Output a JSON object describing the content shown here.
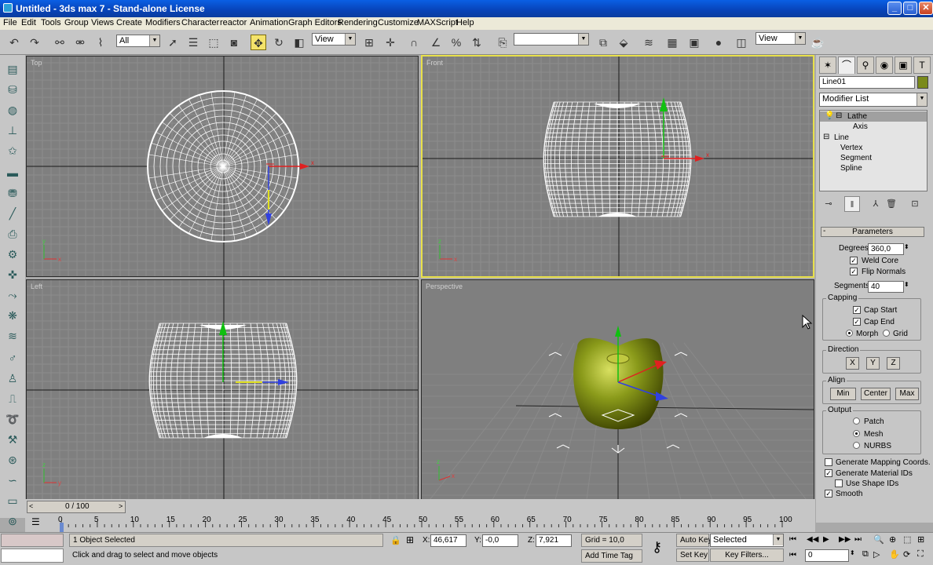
{
  "window": {
    "title": "Untitled    - 3ds max 7    - Stand-alone License",
    "min": "_",
    "max": "□",
    "close": "✕"
  },
  "menu": [
    "File",
    "Edit",
    "Tools",
    "Group",
    "Views",
    "Create",
    "Modifiers",
    "Character",
    "reactor",
    "Animation",
    "Graph Editors",
    "Rendering",
    "Customize",
    "MAXScript",
    "Help"
  ],
  "toolbar": {
    "selection_filter": "All",
    "ref_coord": "View",
    "named_sel": "",
    "render_view": "View"
  },
  "viewports": {
    "top": "Top",
    "front": "Front",
    "left": "Left",
    "perspective": "Perspective"
  },
  "axis": {
    "x": "x",
    "y": "y",
    "z": "z"
  },
  "command_panel": {
    "object_name": "Line01",
    "modifier_list": "Modifier List",
    "stack": {
      "lathe": "Lathe",
      "axis": "Axis",
      "line": "Line",
      "vertex": "Vertex",
      "segment": "Segment",
      "spline": "Spline"
    },
    "rollout": "Parameters",
    "degrees_label": "Degrees:",
    "degrees": "360,0",
    "weld_core": "Weld Core",
    "flip_normals": "Flip Normals",
    "segments_label": "Segments:",
    "segments": "40",
    "capping": "Capping",
    "cap_start": "Cap Start",
    "cap_end": "Cap End",
    "morph": "Morph",
    "grid": "Grid",
    "direction": "Direction",
    "dir_x": "X",
    "dir_y": "Y",
    "dir_z": "Z",
    "align": "Align",
    "min": "Min",
    "center": "Center",
    "max": "Max",
    "output": "Output",
    "patch": "Patch",
    "mesh": "Mesh",
    "nurbs": "NURBS",
    "gen_mapping": "Generate Mapping Coords.",
    "gen_material": "Generate Material IDs",
    "use_shape": "Use Shape IDs",
    "smooth": "Smooth"
  },
  "timeline": {
    "frame": "0 / 100",
    "ticks": [
      "0",
      "5",
      "10",
      "15",
      "20",
      "25",
      "30",
      "35",
      "40",
      "45",
      "50",
      "55",
      "60",
      "65",
      "70",
      "75",
      "80",
      "85",
      "90",
      "95",
      "100"
    ]
  },
  "status": {
    "selected": "1 Object Selected",
    "prompt": "Click and drag to select and move objects",
    "x_label": "X:",
    "x": "46,617",
    "y_label": "Y:",
    "y": "-0,0",
    "z_label": "Z:",
    "z": "7,921",
    "grid": "Grid = 10,0",
    "add_time_tag": "Add Time Tag",
    "auto_key": "Auto Key",
    "auto_key_mode": "Selected",
    "set_key": "Set Key",
    "key_filters": "Key Filters...",
    "current_frame": "0"
  },
  "colors": {
    "accent_active": "#e8e04a",
    "apple": "#8a9a1a",
    "viewport_bg": "#7f7f7f"
  }
}
